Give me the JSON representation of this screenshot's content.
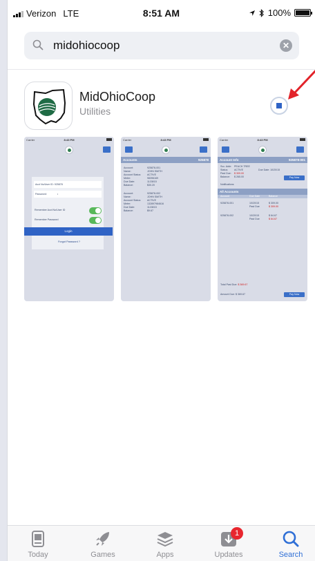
{
  "status_bar": {
    "carrier": "Verizon",
    "network": "LTE",
    "time": "8:51 AM",
    "battery_percent": "100%",
    "battery_level": 1.0
  },
  "search": {
    "query": "midohiocoop"
  },
  "app": {
    "name": "MidOhioCoop",
    "category": "Utilities"
  },
  "screenshots": {
    "login": {
      "carrier": "Carrier",
      "time": "8:43 PM",
      "account_field": "Acct No/User ID: 925878",
      "password_field": "Password:",
      "password_dot": "•",
      "remember_account": "Remember Acct No/User ID",
      "remember_password": "Remember Password",
      "login_label": "Login",
      "forgot_label": "Forgot Password ?"
    },
    "accounts": {
      "carrier": "Carrier",
      "time": "8:43 PM",
      "header": "Accounts",
      "header_id": "925878",
      "account1": [
        [
          "Account:",
          "925878-001"
        ],
        [
          "Name:",
          "JOHN SMITH"
        ],
        [
          "Account Status:",
          "ACTIVE"
        ],
        [
          "Meter:",
          "98396169"
        ],
        [
          "Due Date:",
          "11/28/15"
        ],
        [
          "Balance:",
          "$30.20"
        ]
      ],
      "account2": [
        [
          "Account:",
          "925878-002"
        ],
        [
          "Name:",
          "JOHN SMITH"
        ],
        [
          "Account Status:",
          "ACTIVE"
        ],
        [
          "Meter:",
          "132897984616"
        ],
        [
          "Due Date:",
          "11/28/15"
        ],
        [
          "Balance:",
          "$9.67"
        ]
      ]
    },
    "account_info": {
      "carrier": "Carrier",
      "time": "8:43 PM",
      "header": "Account Info",
      "header_id": "925878-001",
      "svc_addr_label": "Svc. Addr:",
      "svc_addr": "PEACH TREE",
      "status_label": "Status:",
      "status": "ACTIVE",
      "due_date_label": "Due Date:",
      "due_date": "10/20/15",
      "past_due_label": "Past Due:",
      "past_due": "$ 309.00",
      "balance_label": "Balance:",
      "balance": "$ 265.00",
      "pay_now": "Pay Now",
      "notifications_label": "Notifications",
      "all_accounts_header": "All Accounts",
      "col_account": "Account",
      "col_due_date": "Due Date",
      "col_balance": "Balance",
      "rows": [
        {
          "account": "925878-001",
          "date1": "10/20/15",
          "amt1": "$ 309.00",
          "pd_label": "Past Due",
          "pd": "$ 309.00"
        },
        {
          "account": "925878-002",
          "date1": "10/20/15",
          "amt1": "$ 64.67",
          "pd_label": "Past Due",
          "pd": "$ 64.67"
        }
      ],
      "total_past_due_label": "Total Past Due:",
      "total_past_due": "$ 369.67",
      "amount_due_label": "Amount Due:",
      "amount_due": "$ 369.67"
    }
  },
  "tabs": [
    {
      "label": "Today",
      "icon": "today-icon"
    },
    {
      "label": "Games",
      "icon": "rocket-icon"
    },
    {
      "label": "Apps",
      "icon": "stack-icon"
    },
    {
      "label": "Updates",
      "icon": "download-tray-icon",
      "badge": "1"
    },
    {
      "label": "Search",
      "icon": "search-icon"
    }
  ],
  "colors": {
    "accent": "#2f6fd6",
    "badge": "#e8262e",
    "annotation_arrow": "#e2232a"
  }
}
